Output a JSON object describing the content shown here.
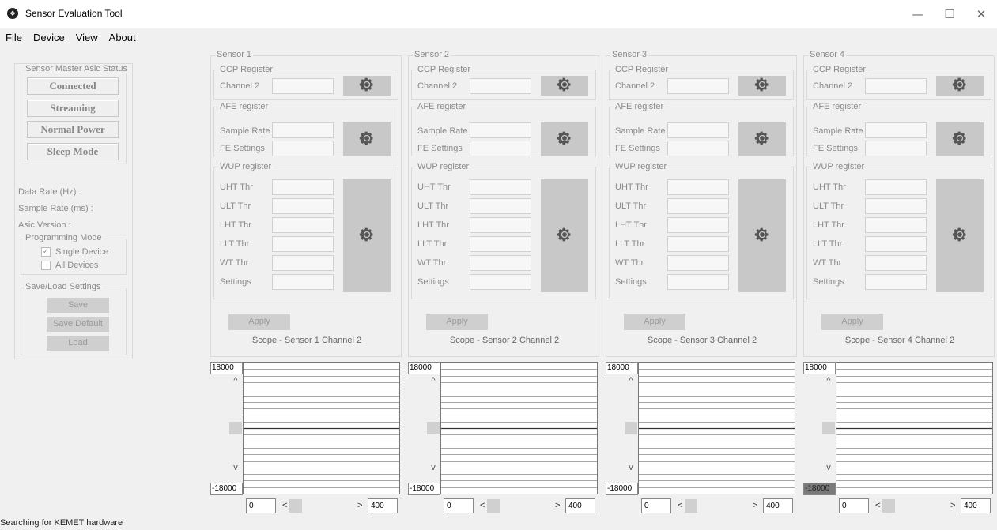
{
  "window": {
    "title": "Sensor Evaluation Tool",
    "minimize_glyph": "—",
    "maximize_glyph": "☐",
    "close_glyph": "✕",
    "app_icon": "kemet-logo-icon"
  },
  "menu": [
    "File",
    "Device",
    "View",
    "About"
  ],
  "left_panel": {
    "status_group": "Sensor Master Asic Status",
    "status_buttons": [
      "Connected",
      "Streaming",
      "Normal Power",
      "Sleep Mode"
    ],
    "data_rate_label": "Data Rate (Hz) :",
    "sample_rate_label": "Sample Rate (ms) :",
    "asic_version_label": "Asic Version :",
    "programming_group": "Programming Mode",
    "single_device": {
      "label": "Single Device",
      "checked": true
    },
    "all_devices": {
      "label": "All Devices",
      "checked": false
    },
    "save_group": "Save/Load Settings",
    "save_buttons": [
      "Save",
      "Save Default",
      "Load"
    ]
  },
  "sensors": [
    {
      "title": "Sensor 1",
      "scope_title": "Scope - Sensor 1 Channel 2"
    },
    {
      "title": "Sensor 2",
      "scope_title": "Scope - Sensor 2 Channel 2"
    },
    {
      "title": "Sensor 3",
      "scope_title": "Scope - Sensor 3 Channel 2"
    },
    {
      "title": "Sensor 4",
      "scope_title": "Scope - Sensor 4 Channel 2"
    }
  ],
  "sensor_labels": {
    "ccp_register": "CCP Register",
    "channel": "Channel 2",
    "afe_register": "AFE register",
    "sample_rate": "Sample Rate",
    "fe_settings": "FE Settings",
    "wup_register": "WUP register",
    "wup_fields": [
      "UHT Thr",
      "ULT Thr",
      "LHT Thr",
      "LLT Thr",
      "WT Thr",
      "Settings"
    ],
    "apply": "Apply"
  },
  "scope": {
    "y_max": "18000",
    "y_min": "-18000",
    "x_min": "0",
    "x_max": "400",
    "up_arrow": "^",
    "down_arrow": "v",
    "left_arrow": "<",
    "right_arrow": ">"
  },
  "status_bar": "Searching for KEMET hardware"
}
